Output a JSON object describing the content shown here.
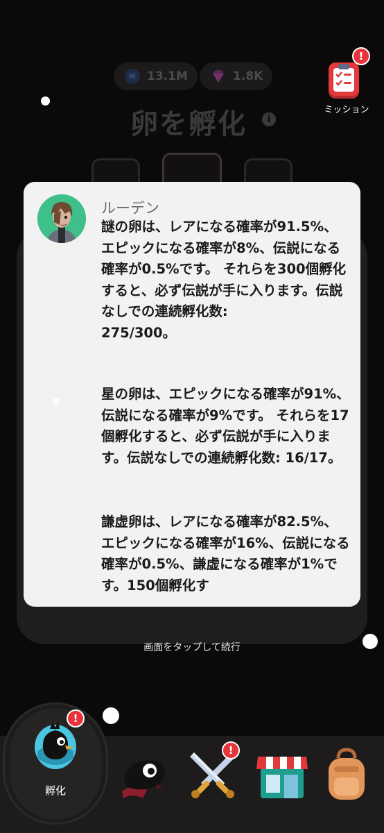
{
  "header": {
    "currency_1_value": "13.1M",
    "currency_2_value": "1.8K",
    "screen_title": "卵を孵化",
    "info_symbol": "i"
  },
  "mission": {
    "label": "ミッション",
    "badge": "!"
  },
  "dialog": {
    "speaker": "ルーデン",
    "paragraphs": [
      "謎の卵は、レアになる確率が91.5%、エピックになる確率が8%、伝説になる確率が0.5%です。 それらを300個孵化すると、必ず伝説が手に入ります。伝説なしでの連続孵化数:\n275/300。",
      "星の卵は、エピックになる確率が91%、伝説になる確率が9%です。 それらを17個孵化すると、必ず伝説が手に入ります。伝説なしでの連続孵化数: 16/17。",
      "謙虚卵は、レアになる確率が82.5%、エピックになる確率が16%、伝説になる確率が0.5%、謙虚になる確率が1%です。150個孵化す"
    ]
  },
  "tap_hint": "画面をタップして続行",
  "bottom_nav": {
    "items": [
      {
        "name": "hatch",
        "label": "孵化",
        "icon": "hatch-bird-icon",
        "badge": "!"
      },
      {
        "name": "pets",
        "label": "",
        "icon": "black-creature-icon"
      },
      {
        "name": "battle",
        "label": "",
        "icon": "crossed-swords-icon",
        "badge": "!"
      },
      {
        "name": "shop",
        "label": "",
        "icon": "shop-icon"
      },
      {
        "name": "bag",
        "label": "",
        "icon": "backpack-icon"
      }
    ]
  },
  "colors": {
    "background": "#0b0909",
    "dialog": "#f2f2f2",
    "badge": "#e8343b",
    "mission_red": "#e23a3a"
  }
}
